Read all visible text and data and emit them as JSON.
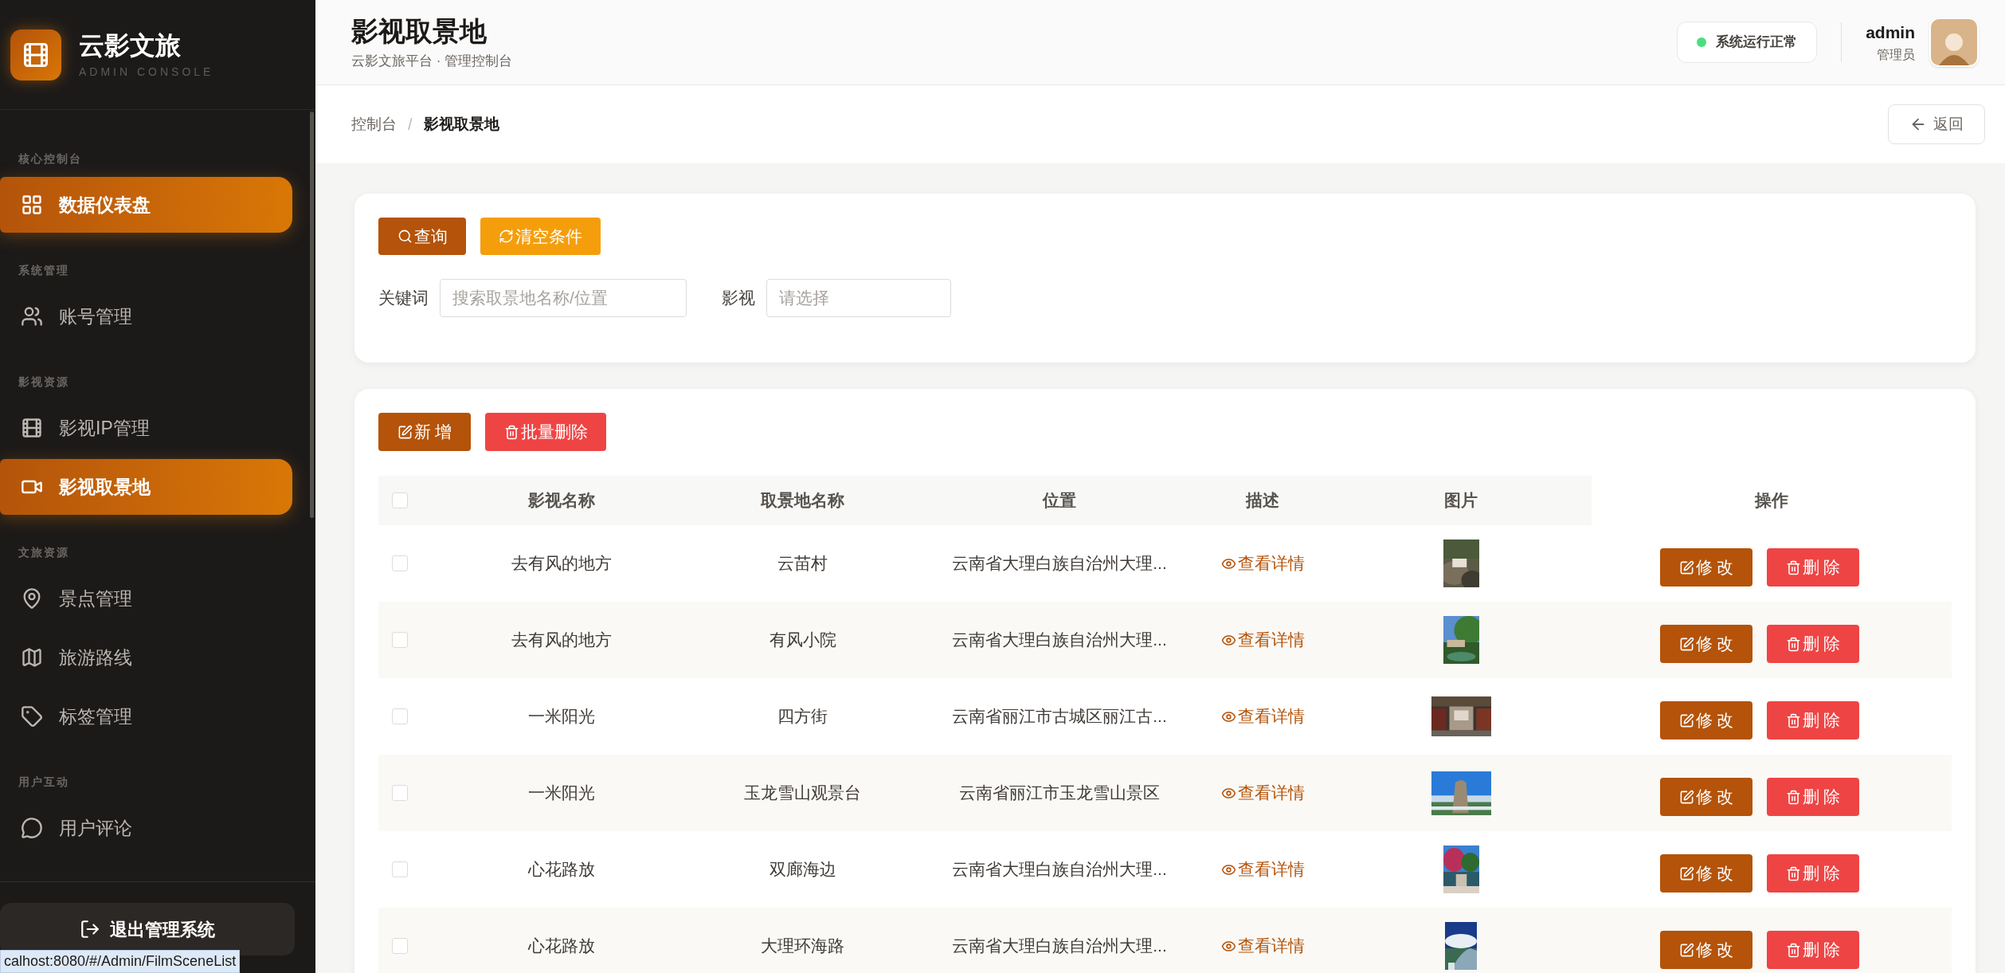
{
  "sidebar": {
    "brand": {
      "title": "云影文旅",
      "subtitle": "ADMIN CONSOLE"
    },
    "sections": [
      {
        "label": "核心控制台",
        "items": [
          {
            "label": "数据仪表盘",
            "selected": true
          }
        ]
      },
      {
        "label": "系统管理",
        "items": [
          {
            "label": "账号管理",
            "selected": false
          }
        ]
      },
      {
        "label": "影视资源",
        "items": [
          {
            "label": "影视IP管理",
            "selected": false
          },
          {
            "label": "影视取景地",
            "selected": true
          }
        ]
      },
      {
        "label": "文旅资源",
        "items": [
          {
            "label": "景点管理",
            "selected": false
          },
          {
            "label": "旅游路线",
            "selected": false
          },
          {
            "label": "标签管理",
            "selected": false
          }
        ]
      },
      {
        "label": "用户互动",
        "items": [
          {
            "label": "用户评论",
            "selected": false
          }
        ]
      }
    ],
    "logout": "退出管理系统"
  },
  "header": {
    "title": "影视取景地",
    "subtitle": "云影文旅平台 · 管理控制台",
    "status": {
      "label": "系统运行正常",
      "color": "#4ade80"
    },
    "user": {
      "name": "admin",
      "role": "管理员"
    }
  },
  "breadcrumb": {
    "items": [
      "控制台",
      "影视取景地"
    ],
    "separator": "/",
    "back_button": "返回"
  },
  "filter": {
    "buttons": [
      {
        "label": "查询",
        "kind": "search"
      },
      {
        "label": "清空条件",
        "kind": "reset"
      }
    ],
    "fields": [
      {
        "label": "关键词",
        "placeholder": "搜索取景地名称/位置"
      },
      {
        "label": "影视",
        "placeholder": "请选择"
      }
    ]
  },
  "table": {
    "actions": [
      {
        "label": "新 增",
        "kind": "add"
      },
      {
        "label": "批量删除",
        "kind": "batch_delete"
      }
    ],
    "header_checked": false,
    "columns": [
      "影视名称",
      "取景地名称",
      "位置",
      "描述",
      "图片",
      "操作"
    ],
    "rows": [
      {
        "checked": false,
        "film": "去有风的地方",
        "location_name": "云苗村",
        "position": "云南省大理白族自治州大理...",
        "description": "查看详情",
        "edit": "修 改",
        "delete": "删 除"
      },
      {
        "checked": false,
        "film": "去有风的地方",
        "location_name": "有风小院",
        "position": "云南省大理白族自治州大理...",
        "description": "查看详情",
        "edit": "修 改",
        "delete": "删 除"
      },
      {
        "checked": false,
        "film": "一米阳光",
        "location_name": "四方街",
        "position": "云南省丽江市古城区丽江古...",
        "description": "查看详情",
        "edit": "修 改",
        "delete": "删 除"
      },
      {
        "checked": false,
        "film": "一米阳光",
        "location_name": "玉龙雪山观景台",
        "position": "云南省丽江市玉龙雪山景区",
        "description": "查看详情",
        "edit": "修 改",
        "delete": "删 除"
      },
      {
        "checked": false,
        "film": "心花路放",
        "location_name": "双廊海边",
        "position": "云南省大理白族自治州大理...",
        "description": "查看详情",
        "edit": "修 改",
        "delete": "删 除"
      },
      {
        "checked": false,
        "film": "心花路放",
        "location_name": "大理环海路",
        "position": "云南省大理白族自治州大理...",
        "description": "查看详情",
        "edit": "修 改",
        "delete": "删 除"
      }
    ]
  },
  "browser_status_url": "calhost:8080/#/Admin/FilmSceneList"
}
